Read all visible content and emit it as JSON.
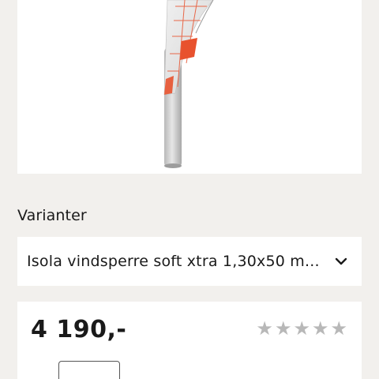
{
  "product": {
    "image_alt": "Isola vindsperre soft xtra rull"
  },
  "variants": {
    "heading": "Varianter",
    "selected": "Isola vindsperre soft xtra 1,30x50 m...",
    "dropdown_icon": "chevron-down-icon"
  },
  "pricing": {
    "price": "4 190,-",
    "rating_stars": 5,
    "rating_filled": 0,
    "star_icon": "star-icon",
    "quantity": ""
  },
  "colors": {
    "page_bg": "#f2f0ed",
    "card_bg": "#ffffff",
    "accent": "#e8522e",
    "star_empty": "#b8b8b8"
  }
}
